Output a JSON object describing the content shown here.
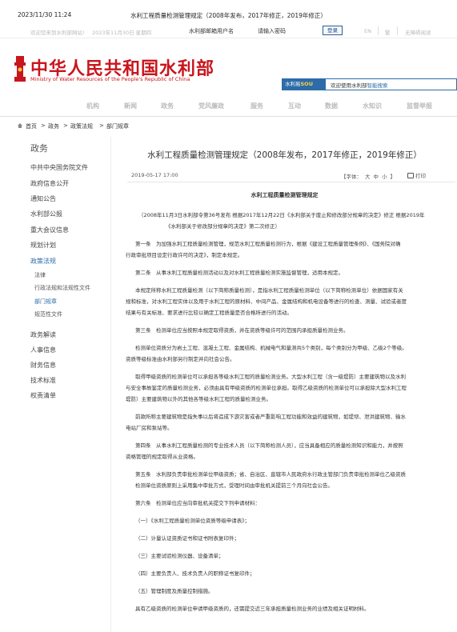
{
  "print_header": {
    "timestamp": "2023/11/30 11:24",
    "page_title": "水利工程质量检测管理规定（2008年发布，2017年修正，2019年修正）"
  },
  "topbar": {
    "welcome": "欢迎您来到水利部网站!",
    "date": "2023年11月30日 星期四",
    "mail_placeholder": "水利部邮箱用户名",
    "password_placeholder": "请输入密码",
    "login": "登录",
    "lang_en": "EN",
    "lang_trad": "繁",
    "accessibility": "无障碍阅读"
  },
  "logo": {
    "cn": "中华人民共和国水利部",
    "en": "Ministry of Water Resources of the People's Republic of China"
  },
  "search": {
    "tag_prefix": "水利易",
    "tag_accent": "SOU",
    "placeholder_prefix": "欢迎使用水利部",
    "placeholder_accent": "智能搜索"
  },
  "nav": [
    "机构",
    "新闻",
    "政务",
    "党风廉政",
    "服务",
    "互动",
    "数据",
    "水知识",
    "监督举报"
  ],
  "breadcrumb": [
    "首页",
    "政务",
    "政策法规",
    "部门规章"
  ],
  "sidebar": {
    "title": "政务",
    "items": [
      {
        "label": "中共中央国务院文件",
        "active": false
      },
      {
        "label": "政府信息公开",
        "active": false
      },
      {
        "label": "通知公告",
        "active": false
      },
      {
        "label": "水利部公报",
        "active": false
      },
      {
        "label": "重大会议信息",
        "active": false
      },
      {
        "label": "规划计划",
        "active": false
      },
      {
        "label": "政策法规",
        "active": true
      }
    ],
    "sub_items": [
      {
        "label": "法律",
        "active": false
      },
      {
        "label": "行政法规和法规性文件",
        "active": false
      },
      {
        "label": "部门规章",
        "active": true
      },
      {
        "label": "规范性文件",
        "active": false
      }
    ],
    "items_after": [
      {
        "label": "政务解读"
      },
      {
        "label": "人事信息"
      },
      {
        "label": "财务信息"
      },
      {
        "label": "技术标准"
      },
      {
        "label": "权责清单"
      }
    ]
  },
  "article": {
    "title": "水利工程质量检测管理规定（2008年发布，2017年修正，2019年修正）",
    "date": "2019-05-17 17:00",
    "font_label": "【字体：",
    "font_large": "大",
    "font_medium": "中",
    "font_small": "小",
    "font_close": "】",
    "print": "打印",
    "doc_title": "水利工程质量检测管理规定",
    "paragraphs": [
      "（2008年11月3日水利部令第36号发布 根据2017年12月22日《水利部关于废止和修改部分规章的决定》修正 根据2019年",
      "《水利部关于修改部分规章的决定》第二次修正）",
      "第一条　为加强水利工程质量检测管理，规范水利工程质量检测行为，根据《建设工程质量管理条例》、《国务院对确",
      "行政审批项目设定行政许可的决定》，制定本规定。",
      "第二条　从事水利工程质量检测活动以及对水利工程质量检测实施监督管理，适用本规定。",
      "本规定所称水利工程质量检测（以下简称质量检测），是指水利工程质量检测单位（以下简称检测单位）依据国家有关",
      "规和标准，对水利工程实体以及用于水利工程的原材料、中间产品、金属结构和机电设备等进行的检查、测量、试验或者度",
      "结果与有关标准、要求进行比较以确定工程质量是否合格所进行的活动。",
      "第三条　检测单位应当按照本规定取得资质，并在资质等级许可的范围内承担质量检测业务。",
      "检测单位资质分为岩土工程、混凝土工程、金属结构、机械电气和量测共5个类别，每个类别分为甲级、乙级2个等级。",
      "资质等级标准由水利部另行制定并向社会公告。",
      "取得甲级资质的检测单位可以承担各等级水利工程的质量检测业务。大型水利工程（含一级堤防）主要建筑物以及水利",
      "与安全事故鉴定的质量检测业务，必须由具有甲级资质的检测单位承担。取得乙级资质的检测单位可以承担除大型水利工程",
      "堤防）主要建筑物以外的其他各等级水利工程的质量检测业务。",
      "前款所称主要建筑物是指失事以后将造成下游灾害或者严重影响工程功能和效益的建筑物，如堤坝、泄洪建筑物、输水",
      "电站厂房和泵站等。",
      "第四条　从事水利工程质量检测的专业技术人员（以下简称检测人员），应当具备相应的质量检测知识和能力，并按照",
      "资格管理的规定取得从业资格。",
      "第五条　水利部负责审批检测单位甲级资质；省、自治区、直辖市人民政府水行政主管部门负责审批检测单位乙级资质",
      "检测单位资质原则上采用集中审批方式，受理时间由审批机关提前三个月向社会公告。",
      "第六条　检测单位应当向审批机关提交下列申请材料：",
      "（一）《水利工程质量检测单位资质等级申请表》；",
      "（二）计量认证资质证书和证书附表复印件；",
      "（三）主要试验检测仪器、设备清单；",
      "（四）主要负责人、技术负责人的职称证书复印件；",
      "（五）管理制度及质量控制措施。",
      "具有乙级资质的检测单位申请甲级资质的，还需提交近三年承担质量检测业务的业绩及相关证明材料。"
    ]
  },
  "colors": {
    "brand_red": "#c8161d",
    "accent_blue": "#2d6ca8"
  }
}
